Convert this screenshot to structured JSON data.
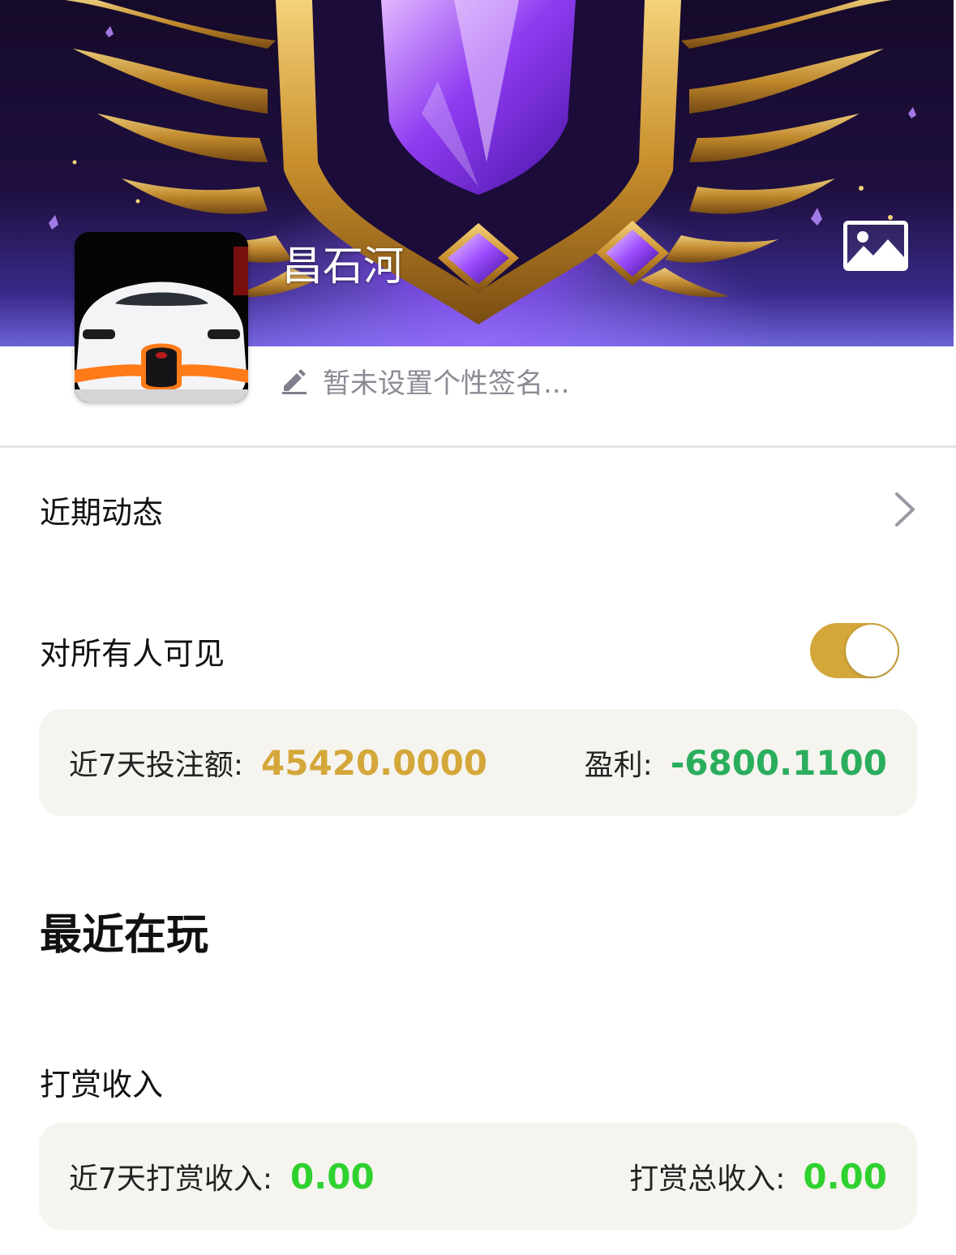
{
  "profile": {
    "username": "昌石河",
    "signature_placeholder": "暂未设置个性签名..."
  },
  "menu": {
    "recent_activity": "近期动态",
    "visible_to_all": "对所有人可见",
    "visible_to_all_enabled": true
  },
  "betting_stats": {
    "week_bet_label": "近7天投注额:",
    "week_bet_value": "45420.0000",
    "profit_label": "盈利:",
    "profit_value": "-6800.1100"
  },
  "recently_playing": {
    "title": "最近在玩"
  },
  "tips": {
    "title": "打赏收入",
    "week_label": "近7天打赏收入:",
    "week_value": "0.00",
    "total_label": "打赏总收入:",
    "total_value": "0.00"
  },
  "colors": {
    "accent_gold": "#d4a73a",
    "bet_value": "#d4a73a",
    "profit_value": "#2aae5e",
    "tip_value": "#2fd12f",
    "card_bg": "#f6f4ef"
  },
  "icons": {
    "banner_button": "image-icon",
    "signature": "pencil-icon",
    "recent_activity": "chevron-right-icon"
  }
}
